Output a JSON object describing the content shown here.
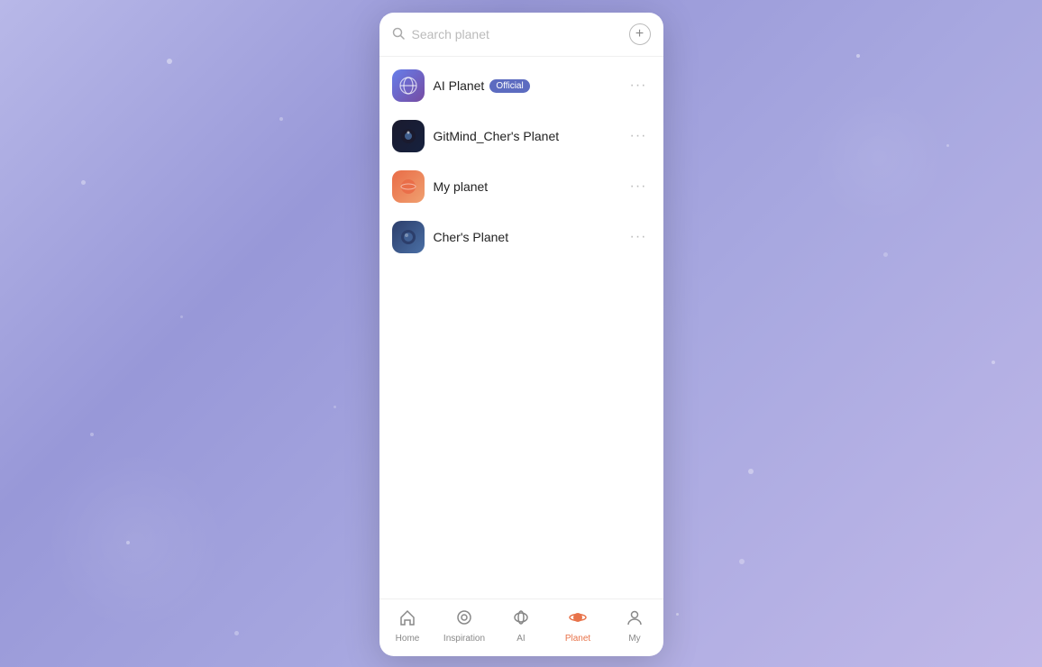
{
  "background": {
    "color": "#a8a8d8"
  },
  "modal": {
    "close_button_label": "×"
  },
  "search": {
    "placeholder": "Search planet",
    "add_icon": "+"
  },
  "planets": [
    {
      "id": "ai-planet",
      "name": "AI Planet",
      "badge": "Official",
      "avatar_type": "ai-planet",
      "avatar_emoji": "🌐"
    },
    {
      "id": "gitmind",
      "name": "GitMind_Cher's Planet",
      "badge": null,
      "avatar_type": "gitmind",
      "avatar_emoji": "🧠"
    },
    {
      "id": "my-planet",
      "name": "My planet",
      "badge": null,
      "avatar_type": "my-planet",
      "avatar_emoji": "🌍"
    },
    {
      "id": "chers-planet",
      "name": "Cher's Planet",
      "badge": null,
      "avatar_type": "chers-planet",
      "avatar_emoji": "🌏"
    }
  ],
  "nav": {
    "items": [
      {
        "id": "home",
        "label": "Home",
        "icon": "⌂",
        "active": false
      },
      {
        "id": "inspiration",
        "label": "Inspiration",
        "icon": "◎",
        "active": false
      },
      {
        "id": "ai",
        "label": "AI",
        "icon": "◉",
        "active": false
      },
      {
        "id": "planet",
        "label": "Planet",
        "icon": "🪐",
        "active": true
      },
      {
        "id": "my",
        "label": "My",
        "icon": "👤",
        "active": false
      }
    ]
  }
}
